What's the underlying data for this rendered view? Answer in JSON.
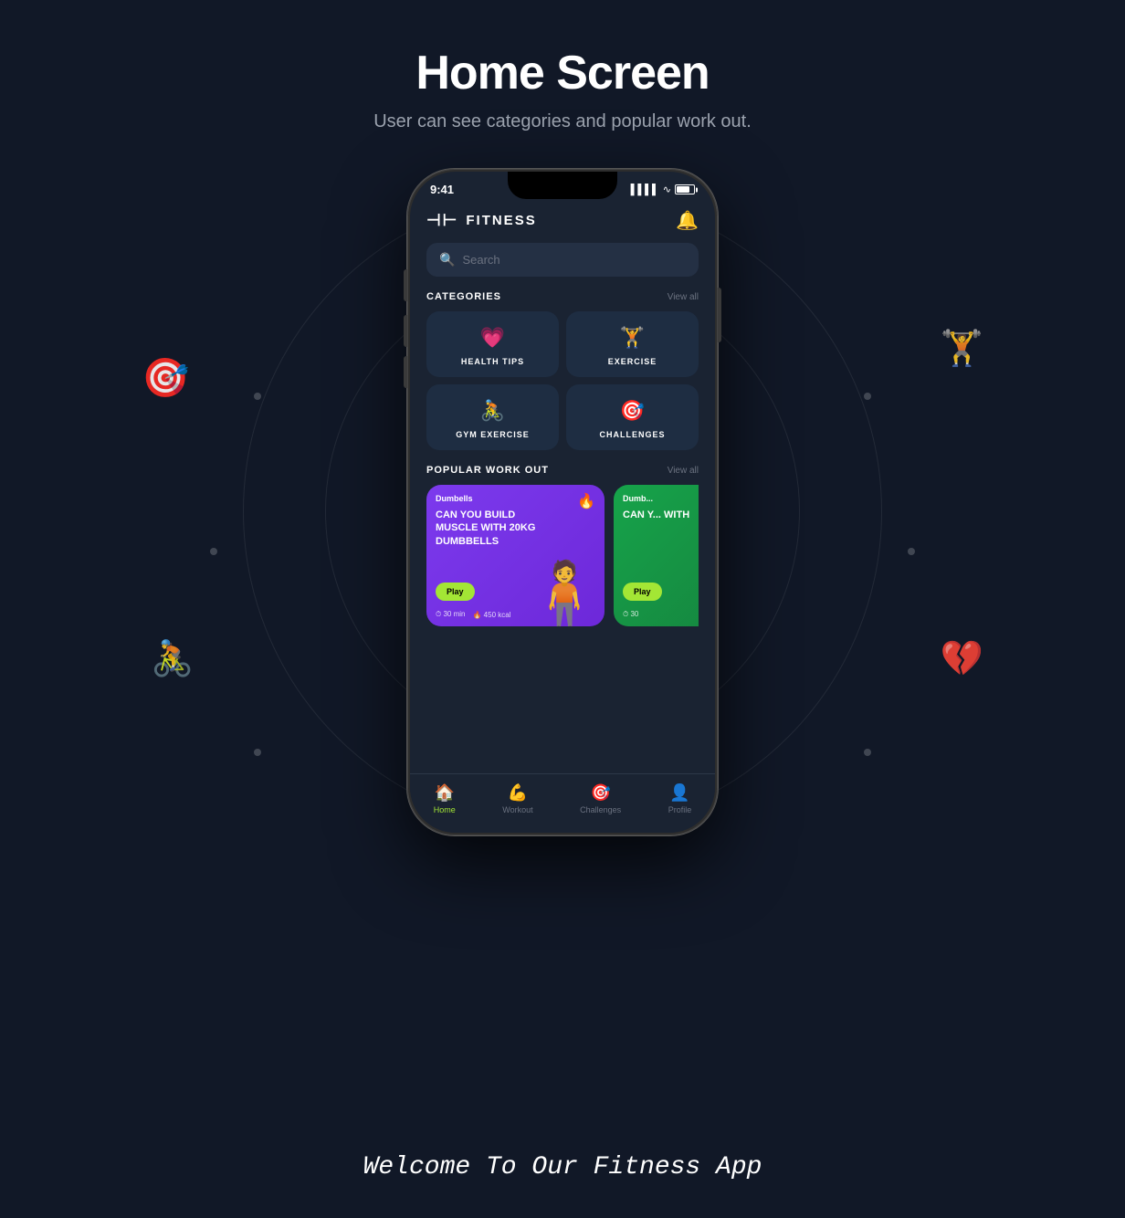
{
  "page": {
    "title": "Home Screen",
    "subtitle": "User can see categories and popular work out.",
    "footer_tagline": "Welcome To Our Fitness App"
  },
  "app": {
    "name": "FITNESS",
    "status_time": "9:41",
    "search_placeholder": "Search",
    "categories_label": "CATEGORIES",
    "view_all_label": "View all",
    "popular_label": "POPULAR WORK OUT",
    "categories": [
      {
        "icon": "❤️",
        "label": "HEALTH TIPS"
      },
      {
        "icon": "🏋️",
        "label": "EXERCISE"
      },
      {
        "icon": "🚴",
        "label": "GYM EXERCISE"
      },
      {
        "icon": "🎯",
        "label": "CHALLENGES"
      }
    ],
    "workouts": [
      {
        "badge": "Dumbells",
        "title": "CAN YOU BUILD MUSCLE WITH 20KG DUMBBELLS",
        "play": "Play",
        "time": "30 min",
        "calories": "450 kcal",
        "theme": "purple"
      },
      {
        "badge": "Dumb...",
        "title": "CAN Y... WITH",
        "play": "Pla...",
        "time": "30",
        "calories": "",
        "theme": "green"
      }
    ],
    "nav": [
      {
        "icon": "🏠",
        "label": "Home",
        "active": true
      },
      {
        "icon": "💪",
        "label": "Workout",
        "active": false
      },
      {
        "icon": "🎯",
        "label": "Challenges",
        "active": false
      },
      {
        "icon": "👤",
        "label": "Profile",
        "active": false
      }
    ]
  }
}
